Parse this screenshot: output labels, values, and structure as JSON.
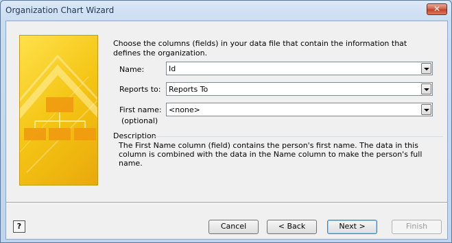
{
  "window": {
    "title": "Organization Chart Wizard",
    "close_glyph": "✕"
  },
  "intro": "Choose the columns (fields) in your data file that contain the information that defines the organization.",
  "fields": [
    {
      "label": "Name:",
      "value": "Id"
    },
    {
      "label": "Reports to:",
      "value": "Reports To"
    },
    {
      "label": "First name:",
      "sublabel": "(optional)",
      "value": "<none>"
    }
  ],
  "description": {
    "title": "Description",
    "text": "The First Name column (field) contains the person's first name. The data in this column is combined with the data in the Name column to make the person's full name."
  },
  "buttons": {
    "help": "?",
    "cancel": "Cancel",
    "back": "< Back",
    "next": "Next >",
    "finish": "Finish"
  },
  "colors": {
    "accent_yellow": "#f4c514",
    "title_bar": "#c9dcf2"
  }
}
